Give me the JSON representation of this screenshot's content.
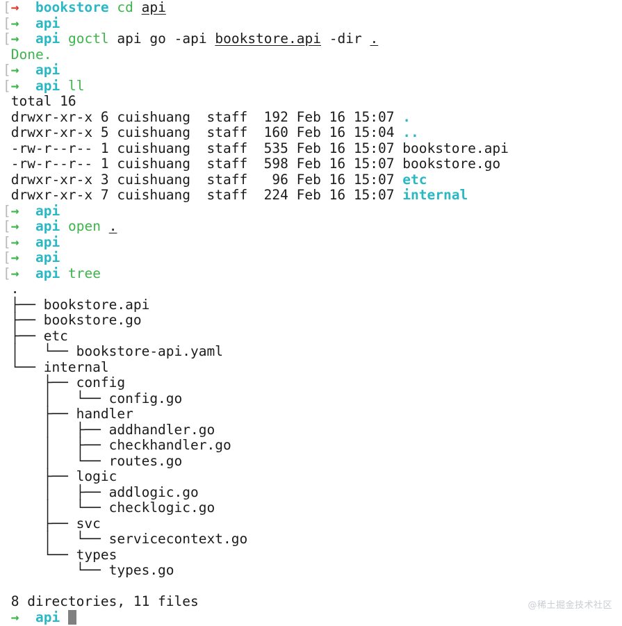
{
  "terminal": {
    "background_color": "#ffffff",
    "foreground_color": "#1b1b1b",
    "prompt_bracket_color": "#b9b9b9",
    "prompt_arrow_error_color": "#e0392d",
    "prompt_arrow_ok_color": "#3cb54a",
    "cwd_color": "#2bb8c4",
    "command_color": "#3cb54a",
    "directory_color": "#2bb8c4",
    "cursor_color": "#808080",
    "bracket": "[",
    "arrow": "→",
    "cwd_bookstore": "bookstore",
    "cwd_api": "api"
  },
  "lines": [
    {
      "kind": "prompt",
      "arrow": "error",
      "cwd": "bookstore",
      "cmd": "cd",
      "args": [
        {
          "text": "api",
          "underline": true
        }
      ]
    },
    {
      "kind": "prompt",
      "arrow": "ok",
      "cwd": "api",
      "cmd": "",
      "args": []
    },
    {
      "kind": "prompt",
      "arrow": "ok",
      "cwd": "api",
      "cmd": "goctl",
      "args": [
        {
          "text": "api",
          "underline": false
        },
        {
          "text": "go",
          "underline": false
        },
        {
          "text": "-api",
          "underline": false
        },
        {
          "text": "bookstore.api",
          "underline": true
        },
        {
          "text": "-dir",
          "underline": false
        },
        {
          "text": ".",
          "underline": true
        }
      ]
    },
    {
      "kind": "output-green",
      "text": "Done."
    },
    {
      "kind": "prompt",
      "arrow": "ok",
      "cwd": "api",
      "cmd": "",
      "args": []
    },
    {
      "kind": "prompt",
      "arrow": "ok",
      "cwd": "api",
      "cmd": "ll",
      "args": []
    },
    {
      "kind": "output",
      "text": "total 16"
    },
    {
      "kind": "ls",
      "perms": "drwxr-xr-x",
      "links": "6",
      "owner": "cuishuang",
      "group": "staff",
      "size": "192",
      "month": "Feb",
      "day": "16",
      "time": "15:07",
      "name": ".",
      "is_dir": true
    },
    {
      "kind": "ls",
      "perms": "drwxr-xr-x",
      "links": "5",
      "owner": "cuishuang",
      "group": "staff",
      "size": "160",
      "month": "Feb",
      "day": "16",
      "time": "15:04",
      "name": "..",
      "is_dir": true
    },
    {
      "kind": "ls",
      "perms": "-rw-r--r--",
      "links": "1",
      "owner": "cuishuang",
      "group": "staff",
      "size": "535",
      "month": "Feb",
      "day": "16",
      "time": "15:07",
      "name": "bookstore.api",
      "is_dir": false
    },
    {
      "kind": "ls",
      "perms": "-rw-r--r--",
      "links": "1",
      "owner": "cuishuang",
      "group": "staff",
      "size": "598",
      "month": "Feb",
      "day": "16",
      "time": "15:07",
      "name": "bookstore.go",
      "is_dir": false
    },
    {
      "kind": "ls",
      "perms": "drwxr-xr-x",
      "links": "3",
      "owner": "cuishuang",
      "group": "staff",
      "size": "96",
      "month": "Feb",
      "day": "16",
      "time": "15:07",
      "name": "etc",
      "is_dir": true
    },
    {
      "kind": "ls",
      "perms": "drwxr-xr-x",
      "links": "7",
      "owner": "cuishuang",
      "group": "staff",
      "size": "224",
      "month": "Feb",
      "day": "16",
      "time": "15:07",
      "name": "internal",
      "is_dir": true
    },
    {
      "kind": "prompt",
      "arrow": "ok",
      "cwd": "api",
      "cmd": "",
      "args": []
    },
    {
      "kind": "prompt",
      "arrow": "ok",
      "cwd": "api",
      "cmd": "open",
      "args": [
        {
          "text": ".",
          "underline": true
        }
      ]
    },
    {
      "kind": "prompt",
      "arrow": "ok",
      "cwd": "api",
      "cmd": "",
      "args": []
    },
    {
      "kind": "prompt",
      "arrow": "ok",
      "cwd": "api",
      "cmd": "",
      "args": []
    },
    {
      "kind": "prompt",
      "arrow": "ok",
      "cwd": "api",
      "cmd": "tree",
      "args": []
    },
    {
      "kind": "tree",
      "text": "."
    },
    {
      "kind": "tree",
      "text": "├── bookstore.api"
    },
    {
      "kind": "tree",
      "text": "├── bookstore.go"
    },
    {
      "kind": "tree",
      "text": "├── etc"
    },
    {
      "kind": "tree",
      "text": "│   └── bookstore-api.yaml"
    },
    {
      "kind": "tree",
      "text": "└── internal"
    },
    {
      "kind": "tree",
      "text": "    ├── config"
    },
    {
      "kind": "tree",
      "text": "    │   └── config.go"
    },
    {
      "kind": "tree",
      "text": "    ├── handler"
    },
    {
      "kind": "tree",
      "text": "    │   ├── addhandler.go"
    },
    {
      "kind": "tree",
      "text": "    │   ├── checkhandler.go"
    },
    {
      "kind": "tree",
      "text": "    │   └── routes.go"
    },
    {
      "kind": "tree",
      "text": "    ├── logic"
    },
    {
      "kind": "tree",
      "text": "    │   ├── addlogic.go"
    },
    {
      "kind": "tree",
      "text": "    │   └── checklogic.go"
    },
    {
      "kind": "tree",
      "text": "    ├── svc"
    },
    {
      "kind": "tree",
      "text": "    │   └── servicecontext.go"
    },
    {
      "kind": "tree",
      "text": "    └── types"
    },
    {
      "kind": "tree",
      "text": "        └── types.go"
    },
    {
      "kind": "blank",
      "text": ""
    },
    {
      "kind": "output",
      "text": "8 directories, 11 files"
    },
    {
      "kind": "prompt-final",
      "arrow": "ok",
      "cwd": "api",
      "cmd": "",
      "args": []
    }
  ],
  "watermark": {
    "text": "@稀土掘金技术社区"
  }
}
